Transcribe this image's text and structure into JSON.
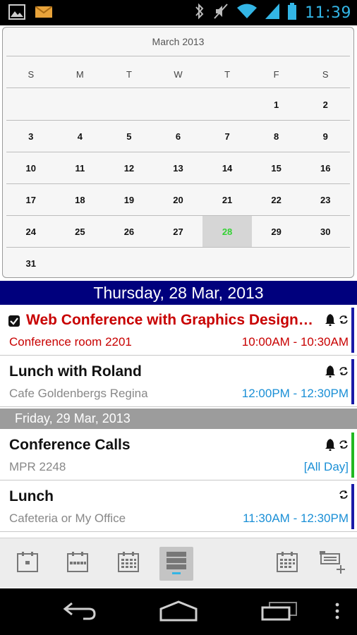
{
  "status_bar": {
    "time": "11:39",
    "left_icons": [
      "gallery-icon",
      "email-icon"
    ],
    "right_icons": [
      "bluetooth-icon",
      "muted-icon",
      "wifi-icon",
      "signal-icon",
      "battery-icon"
    ]
  },
  "calendar": {
    "title": "March 2013",
    "weekday_headers": [
      "S",
      "M",
      "T",
      "W",
      "T",
      "F",
      "S"
    ],
    "weeks": [
      [
        "",
        "",
        "",
        "",
        "",
        "1",
        "2"
      ],
      [
        "3",
        "4",
        "5",
        "6",
        "7",
        "8",
        "9"
      ],
      [
        "10",
        "11",
        "12",
        "13",
        "14",
        "15",
        "16"
      ],
      [
        "17",
        "18",
        "19",
        "20",
        "21",
        "22",
        "23"
      ],
      [
        "24",
        "25",
        "26",
        "27",
        "28",
        "29",
        "30"
      ],
      [
        "31",
        "",
        "",
        "",
        "",
        "",
        ""
      ]
    ],
    "selected_day": "28",
    "selected_color": "#34d234"
  },
  "agenda": {
    "day1_header": "Thursday, 28 Mar, 2013",
    "day2_header": "Friday, 29 Mar, 2013",
    "events": [
      {
        "title": "Web Conference with Graphics Design…",
        "location": "Conference room 2201",
        "time": "10:00AM - 10:30AM",
        "has_alarm": true,
        "has_repeat": true,
        "checked": true,
        "color": "#c80000",
        "bar_color": "#1a1aa8"
      },
      {
        "title": "Lunch with Roland",
        "location": "Cafe Goldenbergs Regina",
        "time": "12:00PM - 12:30PM",
        "has_alarm": true,
        "has_repeat": true,
        "bar_color": "#1a1aa8"
      },
      {
        "title": "Conference Calls",
        "location": "MPR 2248",
        "time": "[All Day]",
        "has_alarm": true,
        "has_repeat": true,
        "bar_color": "#22b822"
      },
      {
        "title": "Lunch",
        "location": "Cafeteria or My Office",
        "time": "11:30AM - 12:30PM",
        "has_alarm": false,
        "has_repeat": true,
        "bar_color": "#1a1aa8"
      }
    ]
  },
  "toolbar": {
    "buttons": [
      "day-view-icon",
      "week-view-icon",
      "month-view-icon",
      "agenda-view-icon",
      "go-to-today-icon",
      "add-event-icon"
    ],
    "active": "agenda-view-icon"
  },
  "navbar": {
    "buttons": [
      "back-icon",
      "home-icon",
      "recent-apps-icon",
      "menu-icon"
    ]
  },
  "colors": {
    "primary_header_bg": "#00007d",
    "secondary_header_bg": "#9c9c9c",
    "time_blue": "#1a8fd6",
    "accent_red": "#c80000"
  }
}
